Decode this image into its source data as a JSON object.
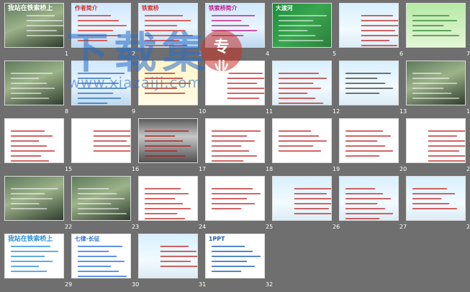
{
  "app": {
    "view": "slide-sorter"
  },
  "slides": [
    {
      "number": "1",
      "style": "bg-photo",
      "label": "我站在铁索桥上",
      "accent": "#ffffff"
    },
    {
      "number": "2",
      "style": "bg-blue",
      "label": "作者简介",
      "accent": "#d0342c"
    },
    {
      "number": "3",
      "style": "bg-blue",
      "label": "铁索桥",
      "accent": "#d0342c"
    },
    {
      "number": "4",
      "style": "bg-blue",
      "label": "铁索桥简介",
      "accent": "#c01f8b"
    },
    {
      "number": "5",
      "style": "bg-map",
      "label": "大渡河",
      "accent": "#ffffff"
    },
    {
      "number": "6",
      "style": "bg-light",
      "label": "",
      "accent": "#c03030"
    },
    {
      "number": "7",
      "style": "bg-green",
      "label": "",
      "accent": "#3b8a3b"
    },
    {
      "number": "8",
      "style": "bg-photo",
      "label": "",
      "accent": "#ffffff"
    },
    {
      "number": "9",
      "style": "bg-blue",
      "label": "",
      "accent": "#3070b0"
    },
    {
      "number": "10",
      "style": "bg-yellow",
      "label": "",
      "accent": "#b03030"
    },
    {
      "number": "11",
      "style": "bg-white",
      "label": "",
      "accent": "#c03030"
    },
    {
      "number": "12",
      "style": "bg-light",
      "label": "",
      "accent": "#c03030"
    },
    {
      "number": "13",
      "style": "bg-light",
      "label": "",
      "accent": "#444444"
    },
    {
      "number": "14",
      "style": "bg-photo",
      "label": "",
      "accent": "#ffffff"
    },
    {
      "number": "15",
      "style": "bg-white",
      "label": "",
      "accent": "#c03030"
    },
    {
      "number": "16",
      "style": "bg-white",
      "label": "",
      "accent": "#c03030"
    },
    {
      "number": "17",
      "style": "bg-dark",
      "label": "",
      "accent": "#b02020"
    },
    {
      "number": "18",
      "style": "bg-white",
      "label": "",
      "accent": "#c03030"
    },
    {
      "number": "19",
      "style": "bg-white",
      "label": "",
      "accent": "#c03030"
    },
    {
      "number": "20",
      "style": "bg-white",
      "label": "",
      "accent": "#c03030"
    },
    {
      "number": "21",
      "style": "bg-white",
      "label": "",
      "accent": "#c03030"
    },
    {
      "number": "22",
      "style": "bg-photo",
      "label": "",
      "accent": "#ffffff"
    },
    {
      "number": "23",
      "style": "bg-photo",
      "label": "",
      "accent": "#ffffff"
    },
    {
      "number": "24",
      "style": "bg-white",
      "label": "",
      "accent": "#c03030"
    },
    {
      "number": "25",
      "style": "bg-white",
      "label": "",
      "accent": "#c03030"
    },
    {
      "number": "26",
      "style": "bg-light",
      "label": "",
      "accent": "#c03030"
    },
    {
      "number": "27",
      "style": "bg-light",
      "label": "",
      "accent": "#c03030"
    },
    {
      "number": "28",
      "style": "bg-light",
      "label": "",
      "accent": "#c03030"
    },
    {
      "number": "29",
      "style": "bg-white",
      "label": "我站在铁索桥上",
      "accent": "#2a8fd8"
    },
    {
      "number": "30",
      "style": "bg-white",
      "label": "七律·长征",
      "accent": "#2a6fd8"
    },
    {
      "number": "31",
      "style": "bg-light",
      "label": "",
      "accent": "#c03030"
    },
    {
      "number": "32",
      "style": "bg-ppt",
      "label": "1PPT",
      "accent": "#1a5fb4"
    }
  ],
  "watermark": {
    "main": "下载集",
    "badge_top": "专",
    "badge_bottom": "业",
    "url": "www.xiazaiji.com"
  }
}
